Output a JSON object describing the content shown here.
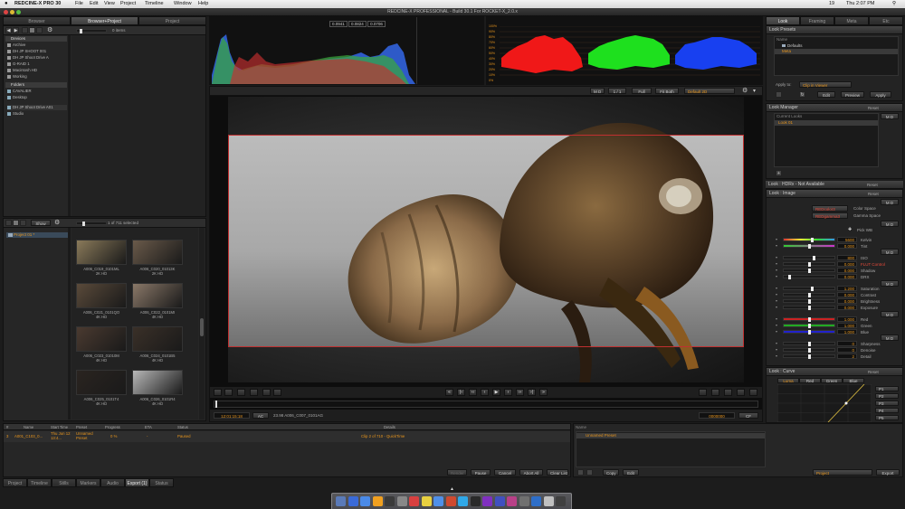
{
  "menubar": {
    "app": "REDCINE-X PRO 30",
    "menus": [
      "File",
      "Edit",
      "View",
      "Project",
      "Timeline",
      "Window",
      "Help"
    ],
    "battery": "19",
    "clock": "Thu 2:07 PM",
    "window_title": "REDCINE-X PROFESSIONAL - Build 30.1 For ROCKET-X_2.0.x"
  },
  "left_tabs": [
    "Browser",
    "Browser+Project",
    "Project"
  ],
  "browser": {
    "item_count": "0 items",
    "devices_header": "Devices",
    "devices": [
      "Archive",
      "DH JP SHOOT 001",
      "DH JP Shoot Drive A",
      "G-RAID 1",
      "Macintosh HD",
      "Working"
    ],
    "folders_header": "Folders",
    "folders": [
      "CAVALIER",
      "Desktop"
    ],
    "extra": [
      "DH JP Shoot Drive A01",
      "Studio"
    ]
  },
  "project_bin": {
    "show_label": "Show",
    "selected_count": "1 of 711 selected",
    "project_name": "Project 01 *",
    "clips": [
      {
        "name": "A006_C019_0101ML",
        "res": "2K HD",
        "color": "#8a7a5a"
      },
      {
        "name": "A006_C020_01013K",
        "res": "2K HD",
        "color": "#6a5a4a"
      },
      {
        "name": "A006_C021_0101QO",
        "res": "4K HD",
        "color": "#5a4a3a"
      },
      {
        "name": "A006_C022_0101MI",
        "res": "4K HD",
        "color": "#8a7868"
      },
      {
        "name": "A006_C023_01010M",
        "res": "4K HD",
        "color": "#4a3a30"
      },
      {
        "name": "A006_C024_0101B5",
        "res": "4K HD",
        "color": "#3a3028"
      },
      {
        "name": "A006_C025_0101T4",
        "res": "4K HD",
        "color": "#2a2420"
      },
      {
        "name": "A006_C026_0101R4",
        "res": "4K HD",
        "color": "#b8b8b8"
      }
    ]
  },
  "scopes": {
    "rgb_values": [
      "0.0941",
      "0.0824",
      "0.0706"
    ],
    "parade_ticks": [
      "100%",
      "90%",
      "80%",
      "70%",
      "60%",
      "50%",
      "40%",
      "30%",
      "20%",
      "10%",
      "0%"
    ]
  },
  "viewer": {
    "md_label": "M D",
    "page_nav": "1 / 1",
    "zoom": "Full",
    "fit": "Fit Both",
    "lut": "Default 2D",
    "timecode": "12:01:15:18",
    "audio_channel": "AC",
    "clip_info": "23.98  A006_C007_0101AG",
    "end_timecode": "0000000",
    "cf_label": "CF"
  },
  "right_tabs": [
    "Look",
    "Framing",
    "Meta",
    "Etc"
  ],
  "look_presets": {
    "header": "Look Presets",
    "name_col": "Name",
    "items": [
      "Defaults",
      "Meta"
    ],
    "apply_to_label": "Apply to:",
    "apply_to_value": "Clip in Viewer",
    "edit_btn": "Edit",
    "preview_btn": "Preview",
    "apply_btn": "Apply"
  },
  "look_manager": {
    "header": "Look Manager",
    "reset": "Reset",
    "md": "M D",
    "current_looks": "Current Looks",
    "item": "Look 01"
  },
  "hdrx": {
    "header": "Look : HDRx - Not Available",
    "reset": "Reset"
  },
  "image": {
    "header": "Look : Image",
    "reset": "Reset",
    "md": "M D",
    "color_space_value": "REDcolor3",
    "color_space_label": "Color Space",
    "gamma_value": "REDgamma3",
    "gamma_label": "Gamma Space",
    "pick_wb": "Pick WB",
    "rows": [
      {
        "label": "Kelvin",
        "value": "5600",
        "knob": 0.55
      },
      {
        "label": "Tint",
        "value": "0.000",
        "knob": 0.5
      },
      {
        "label": "ISO",
        "value": "800",
        "knob": 0.6
      },
      {
        "label": "FLUT Control",
        "value": "0.000",
        "knob": 0.5
      },
      {
        "label": "Shadow",
        "value": "0.000",
        "knob": 0.5
      },
      {
        "label": "DRX",
        "value": "0.000",
        "knob": 0.1
      },
      {
        "label": "Saturation",
        "value": "1.200",
        "knob": 0.55
      },
      {
        "label": "Contrast",
        "value": "0.000",
        "knob": 0.5
      },
      {
        "label": "Brightness",
        "value": "0.000",
        "knob": 0.5
      },
      {
        "label": "Exposure",
        "value": "0.000",
        "knob": 0.5
      },
      {
        "label": "Red",
        "value": "1.000",
        "knob": 0.5
      },
      {
        "label": "Green",
        "value": "1.000",
        "knob": 0.5
      },
      {
        "label": "Blue",
        "value": "1.000",
        "knob": 0.5
      },
      {
        "label": "Sharpness",
        "value": "0",
        "knob": 0.5
      },
      {
        "label": "Denoise",
        "value": "0",
        "knob": 0.5
      },
      {
        "label": "Detail",
        "value": "2",
        "knob": 0.5
      }
    ]
  },
  "curve": {
    "header": "Look : Curve",
    "reset": "Reset",
    "md": "M D",
    "tabs": [
      "Luma",
      "Red",
      "Green",
      "Blue"
    ],
    "points": [
      "P1",
      "P2",
      "P3",
      "P4",
      "P5"
    ]
  },
  "queue": {
    "columns": [
      "#",
      "Name",
      "Start Time",
      "Preset",
      "Progress",
      "ETA",
      "Status",
      "Details"
    ],
    "row": {
      "num": "3",
      "name": "A001_C103_0...",
      "start": "Thu Jun 12 13:4...",
      "preset": "Unnamed Preset",
      "progress": "0 %",
      "eta": "-",
      "status": "Paused",
      "details": "Clip 2 of 710 - QuickTime"
    },
    "buttons": [
      "Render",
      "Pause",
      "Cancel",
      "Abort All",
      "Clear List"
    ],
    "presets_col": "Name",
    "preset_item": "Unnamed Preset",
    "copy_btn": "Copy",
    "edit_btn": "Edit",
    "target": "Project",
    "export_btn": "Export"
  },
  "bottom_tabs": [
    "Project",
    "Timeline",
    "Stills",
    "Markers",
    "Audio",
    "Export (1)",
    "Status"
  ],
  "colors": {
    "accent": "#e8961e",
    "panel": "#232323",
    "header": "#3a3a3a"
  }
}
